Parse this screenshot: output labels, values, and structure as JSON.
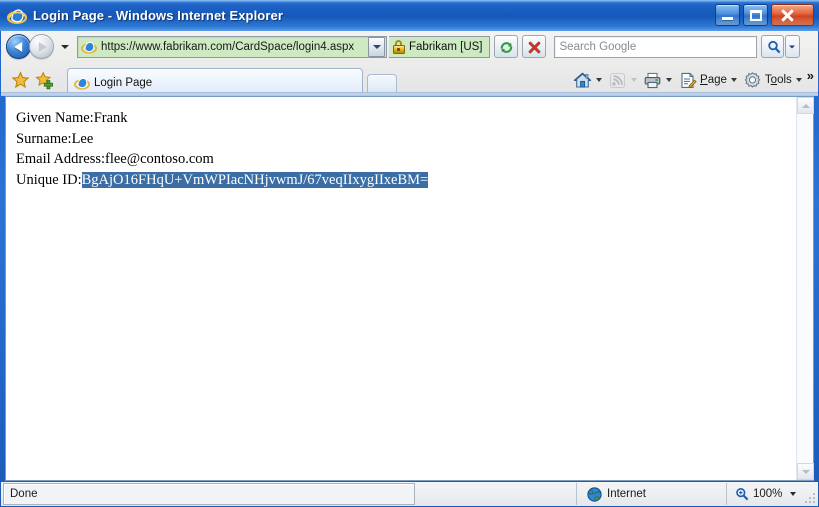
{
  "window": {
    "title": "Login Page - Windows Internet Explorer",
    "app_icon": "internet-explorer-icon",
    "controls": {
      "minimize": "minimize-button",
      "maximize": "maximize-button",
      "close": "close-button"
    },
    "frame_color": "#1f63c6"
  },
  "navigation": {
    "back_label": "Back",
    "forward_label": "Forward",
    "recent_pages_label": "Recent Pages",
    "refresh_label": "Refresh",
    "stop_label": "Stop"
  },
  "address_bar": {
    "url": "https://www.fabrikam.com/CardSpace/login4.aspx",
    "icon": "internet-explorer-icon",
    "dropdown_icon": "chevron-down-icon",
    "background_color": "#cdeac2",
    "ev_certificate": {
      "label": "Fabrikam [US]",
      "icon": "padlock-icon"
    }
  },
  "search": {
    "placeholder": "Search Google",
    "value": "",
    "go_icon": "search-icon",
    "dropdown_icon": "chevron-down-icon"
  },
  "tabs": {
    "favorites_icon": "star-icon",
    "add_favorites_icon": "add-to-favorites-icon",
    "items": [
      {
        "label": "Login Page",
        "icon": "internet-explorer-icon",
        "active": true
      }
    ],
    "new_tab_label": ""
  },
  "command_bar": {
    "items": [
      {
        "label": "",
        "icon": "home-icon",
        "has_dropdown": true,
        "disabled": false
      },
      {
        "label": "",
        "icon": "rss-feed-icon",
        "has_dropdown": true,
        "disabled": true
      },
      {
        "label": "",
        "icon": "print-icon",
        "has_dropdown": true,
        "disabled": false
      },
      {
        "label": "Page",
        "icon": "page-icon",
        "has_dropdown": true,
        "disabled": false
      },
      {
        "label": "Tools",
        "icon": "gear-icon",
        "has_dropdown": true,
        "disabled": false
      }
    ],
    "overflow_label": "»"
  },
  "content": {
    "lines": [
      {
        "label": "Given Name:",
        "value": "Frank",
        "selected": false
      },
      {
        "label": "Surname:",
        "value": "Lee",
        "selected": false
      },
      {
        "label": "Email Address:",
        "value": "flee@contoso.com",
        "selected": false
      },
      {
        "label": "Unique ID:",
        "value": "BgAjO16FHqU+VmWPIacNHjvwmJ/67veqIIxygIIxeBM=",
        "selected": true
      }
    ],
    "selection_color": "#3a6ea5"
  },
  "scrollbar": {
    "up_icon": "chevron-up-icon",
    "down_icon": "chevron-down-icon",
    "enabled": false
  },
  "status_bar": {
    "status_text": "Done",
    "zone_label": "Internet",
    "zone_icon": "globe-icon",
    "zoom_level": "100%",
    "zoom_icon": "zoom-icon",
    "zoom_dropdown_icon": "chevron-down-icon"
  }
}
